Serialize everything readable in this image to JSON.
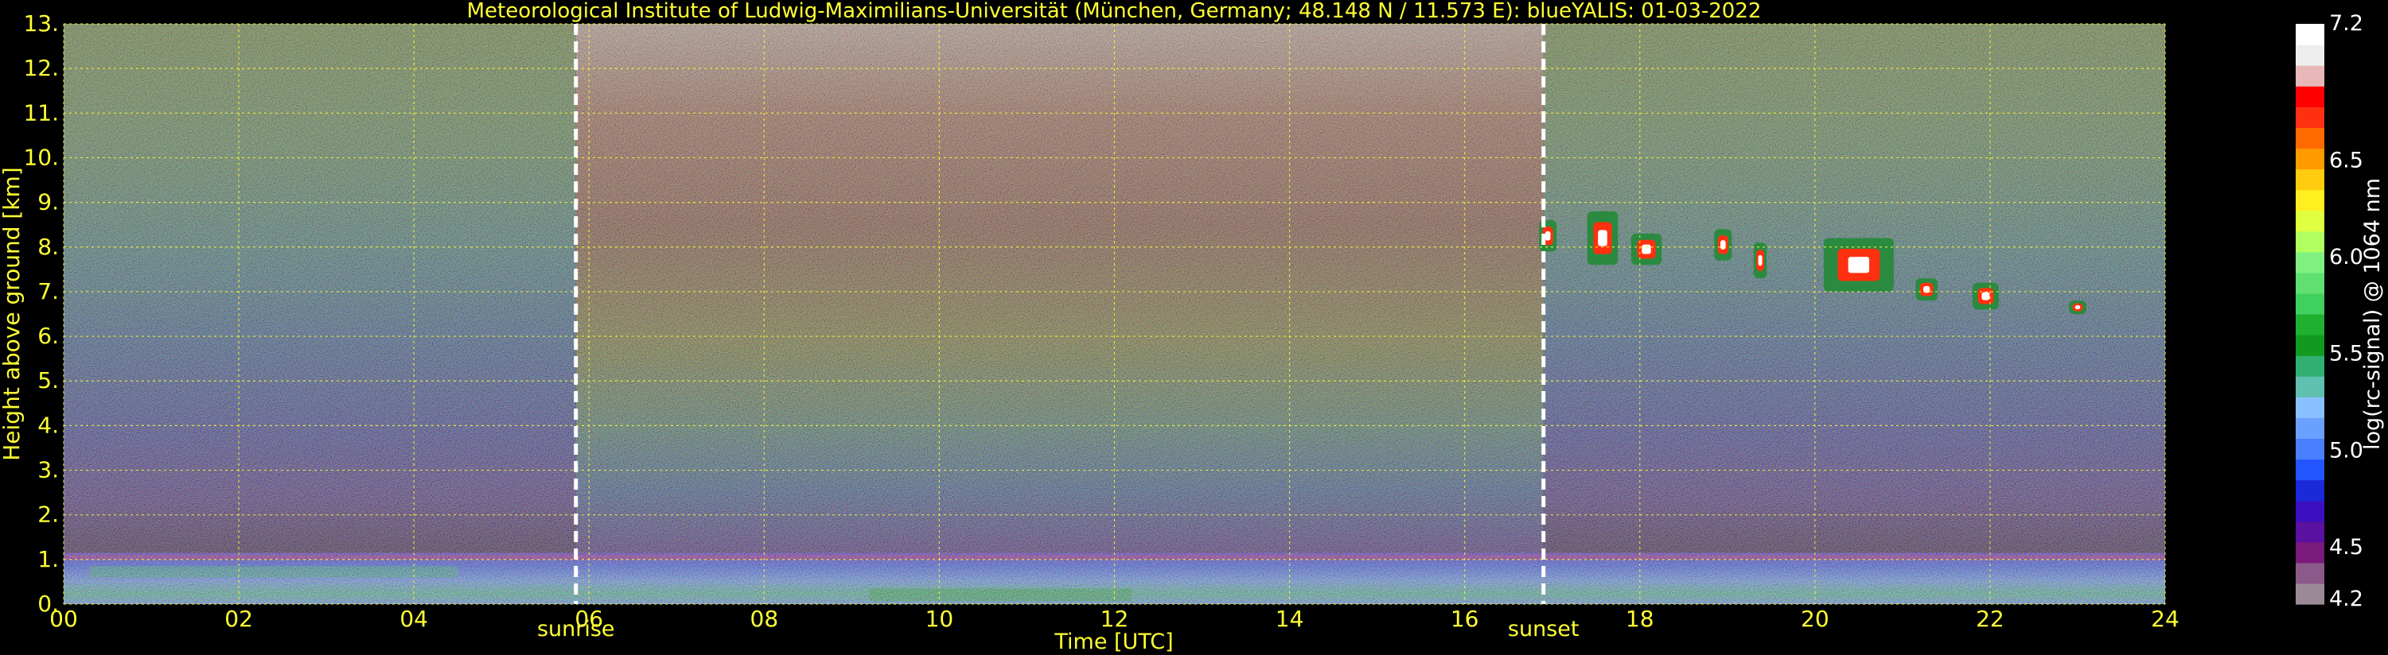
{
  "chart_data": {
    "type": "heatmap",
    "title": "Meteorological Institute of Ludwig-Maximilians-Universität (München, Germany; 48.148 N / 11.573 E):    blueYALIS: 01-03-2022",
    "xlabel": "Time [UTC]",
    "ylabel": "Height above ground [km]",
    "xlim": [
      0,
      24
    ],
    "ylim": [
      0,
      13
    ],
    "x_ticks": [
      "00",
      "02",
      "04",
      "06",
      "08",
      "10",
      "12",
      "14",
      "16",
      "18",
      "20",
      "22",
      "24"
    ],
    "x_tick_values": [
      0,
      2,
      4,
      6,
      8,
      10,
      12,
      14,
      16,
      18,
      20,
      22,
      24
    ],
    "y_ticks": [
      "0.",
      "1.",
      "2.",
      "3.",
      "4.",
      "5.",
      "6.",
      "7.",
      "8.",
      "9.",
      "10.",
      "11.",
      "12.",
      "13."
    ],
    "y_tick_values": [
      0,
      1,
      2,
      3,
      4,
      5,
      6,
      7,
      8,
      9,
      10,
      11,
      12,
      13
    ],
    "grid": true,
    "events": [
      {
        "label": "sunrise",
        "time": 5.85
      },
      {
        "label": "sunset",
        "time": 16.9
      }
    ],
    "clouds": [
      {
        "t0": 16.85,
        "t1": 17.05,
        "h0": 7.9,
        "h1": 8.6
      },
      {
        "t0": 17.4,
        "t1": 17.75,
        "h0": 7.6,
        "h1": 8.8
      },
      {
        "t0": 17.9,
        "t1": 18.25,
        "h0": 7.6,
        "h1": 8.3
      },
      {
        "t0": 18.85,
        "t1": 19.05,
        "h0": 7.7,
        "h1": 8.4
      },
      {
        "t0": 19.3,
        "t1": 19.45,
        "h0": 7.3,
        "h1": 8.1
      },
      {
        "t0": 20.1,
        "t1": 20.9,
        "h0": 7.0,
        "h1": 8.2
      },
      {
        "t0": 21.15,
        "t1": 21.4,
        "h0": 6.8,
        "h1": 7.3
      },
      {
        "t0": 21.8,
        "t1": 22.1,
        "h0": 6.6,
        "h1": 7.2
      },
      {
        "t0": 22.9,
        "t1": 23.1,
        "h0": 6.5,
        "h1": 6.8
      }
    ],
    "colorbar": {
      "label": "log(rc-signal) @ 1064 nm",
      "range": [
        4.2,
        7.2
      ],
      "ticks": [
        "4.2",
        "4.5",
        "5.0",
        "5.5",
        "6.0",
        "6.5",
        "7.2"
      ],
      "tick_values": [
        4.2,
        4.5,
        5.0,
        5.5,
        6.0,
        6.5,
        7.2
      ],
      "colors": [
        "#9a8a98",
        "#8a5a8a",
        "#7a1a7a",
        "#5a10a0",
        "#3a10c0",
        "#1a2ad8",
        "#2255ff",
        "#4a80ff",
        "#6aa0ff",
        "#8ac0ff",
        "#60c0b0",
        "#30b070",
        "#109a20",
        "#20b030",
        "#40d060",
        "#60e070",
        "#80f080",
        "#b0ff60",
        "#e0ff40",
        "#ffee20",
        "#ffcc10",
        "#ff9a00",
        "#ff6a00",
        "#ff3010",
        "#ff0000",
        "#e8b8b8",
        "#eeeeee",
        "#ffffff"
      ]
    }
  }
}
